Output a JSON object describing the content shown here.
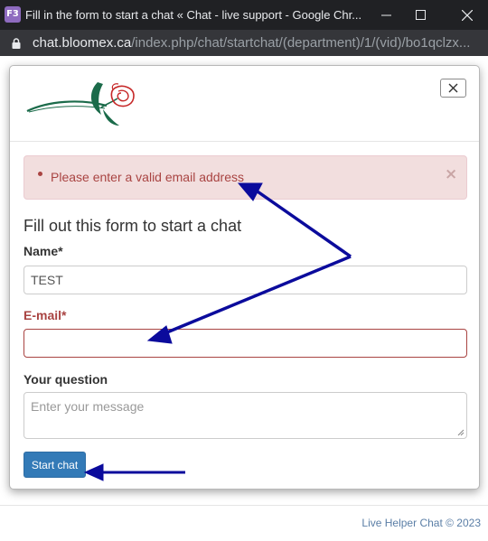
{
  "window": {
    "app_icon_label": "F3",
    "title": "Fill in the form to start a chat « Chat - live support - Google Chr..."
  },
  "address_bar": {
    "host": "chat.bloomex.ca",
    "path": "/index.php/chat/startchat/(department)/1/(vid)/bo1qclzx..."
  },
  "modal": {
    "close_label": "×",
    "alert": {
      "message": "Please enter a valid email address",
      "dismiss_label": "×"
    },
    "form": {
      "heading": "Fill out this form to start a chat",
      "name_label": "Name",
      "name_required_mark": "*",
      "name_value": "TEST",
      "email_label": "E-mail",
      "email_required_mark": "*",
      "email_value": "",
      "question_label": "Your question",
      "question_placeholder": "Enter your message",
      "submit_label": "Start chat"
    }
  },
  "footer": {
    "credit": "Live Helper Chat © 2023"
  },
  "colors": {
    "error_text": "#a94442",
    "error_bg": "#f2dede",
    "primary_button": "#337ab7",
    "annotation_arrow": "#0b0b9c"
  },
  "icons": [
    "app-icon",
    "minimize-icon",
    "maximize-icon",
    "close-window-icon",
    "lock-icon",
    "rose-logo",
    "close-icon",
    "resize-grip-icon"
  ]
}
